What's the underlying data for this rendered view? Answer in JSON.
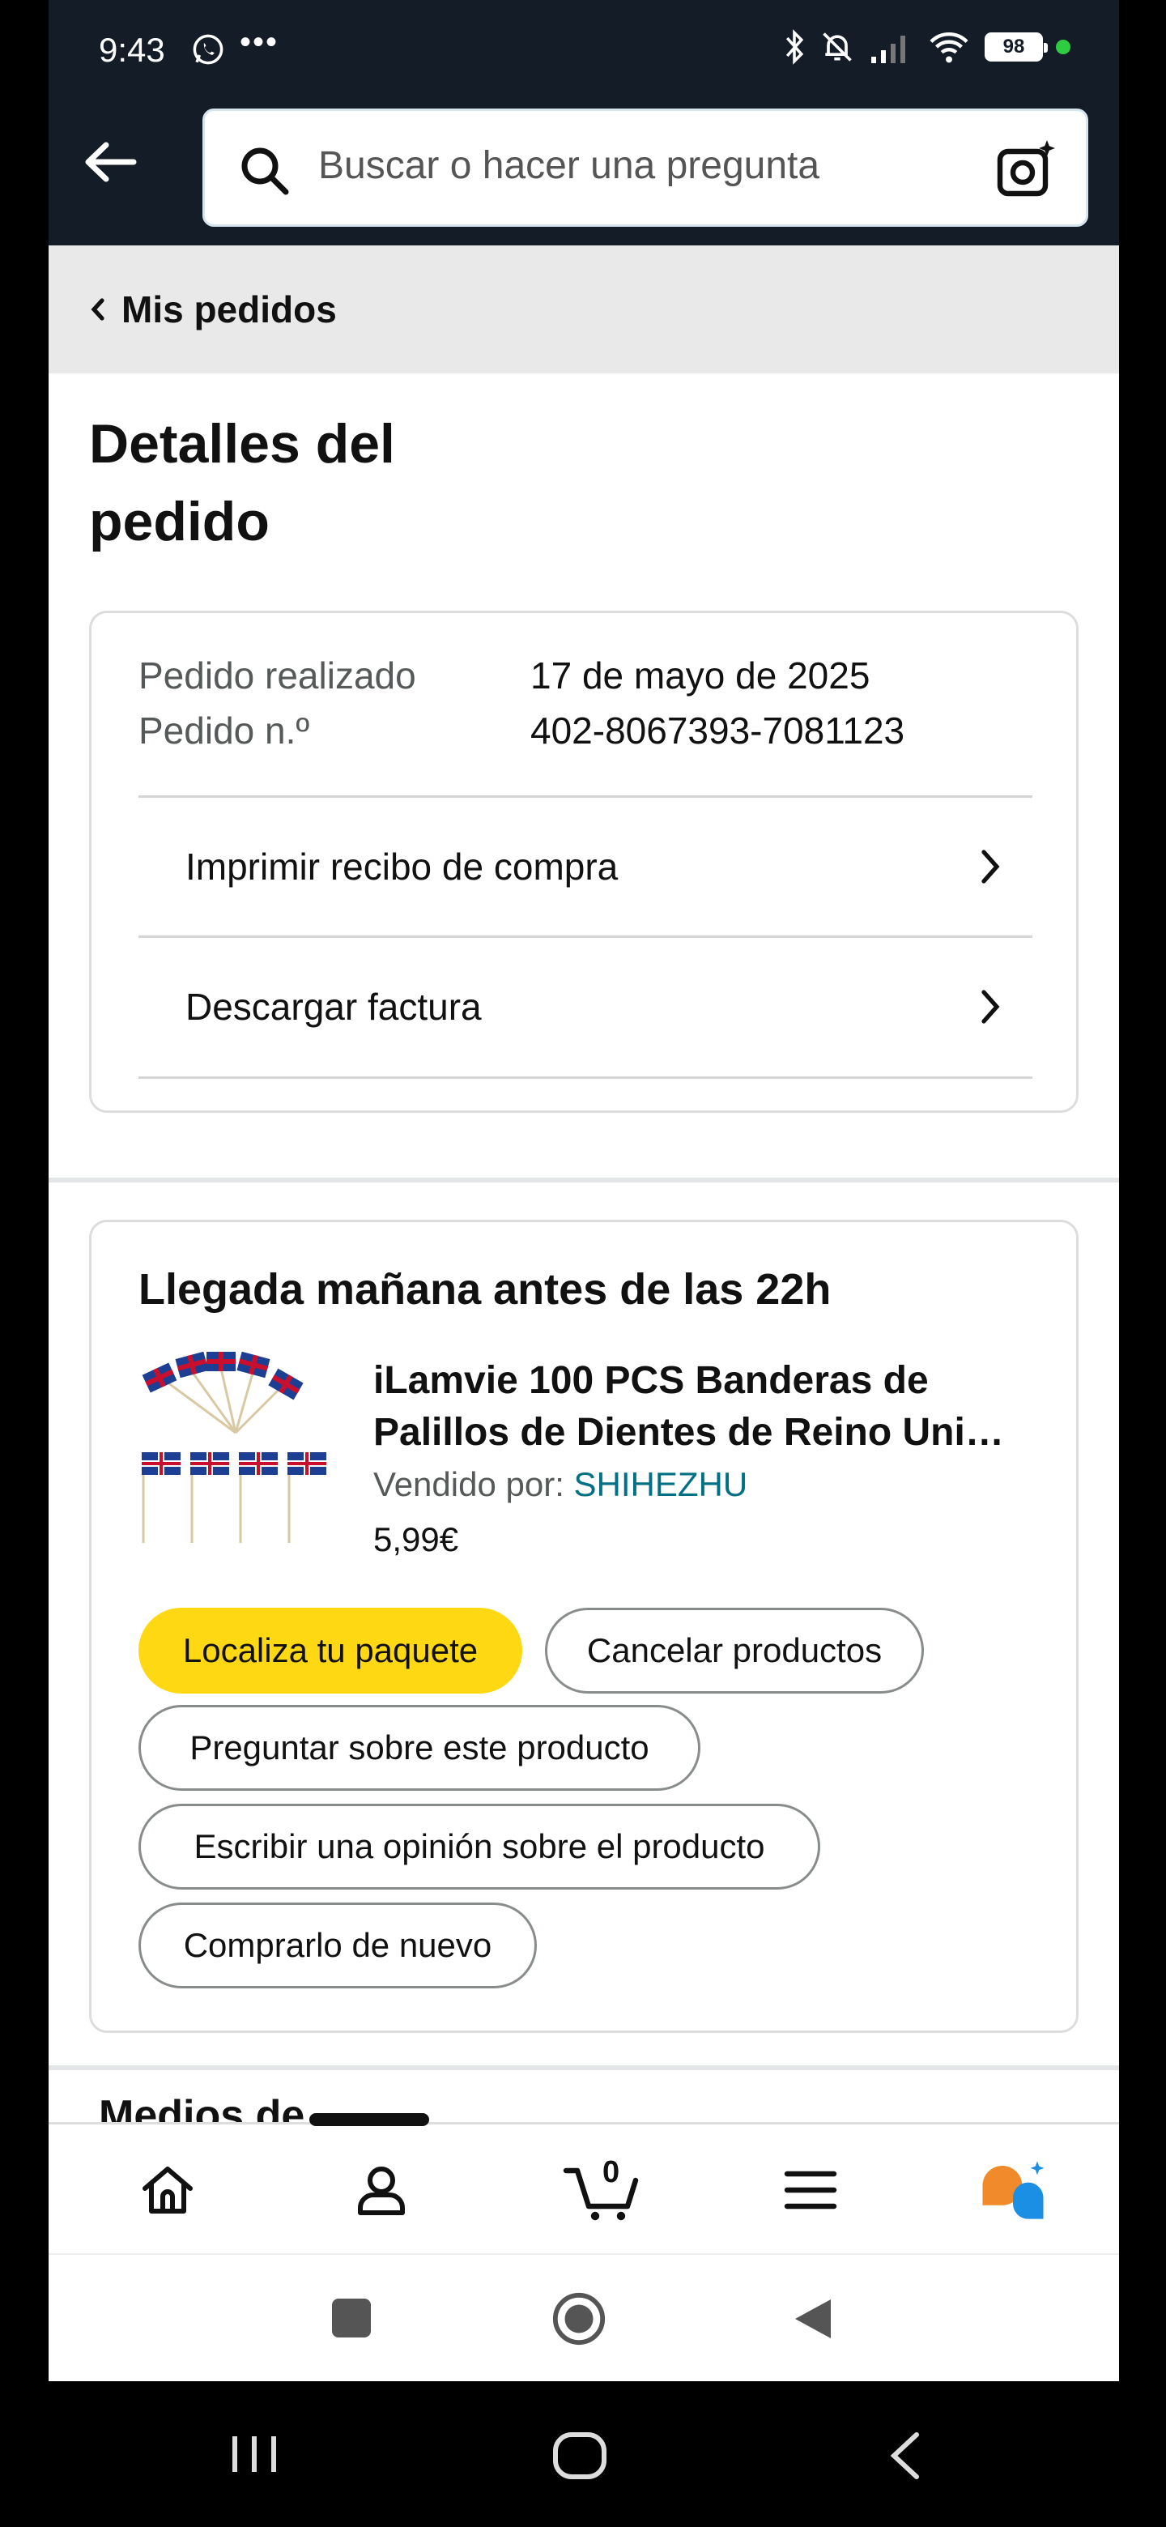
{
  "status_bar": {
    "time": "9:43",
    "dots": "•••",
    "battery": "98"
  },
  "search": {
    "placeholder": "Buscar o hacer una pregunta"
  },
  "breadcrumb": {
    "label": "Mis pedidos"
  },
  "page": {
    "title": "Detalles del pedido"
  },
  "order": {
    "placed_label": "Pedido realizado",
    "placed_value": "17 de mayo de 2025",
    "number_label": "Pedido n.º",
    "number_value": "402-8067393-7081123",
    "links": [
      "Imprimir recibo de compra",
      "Descargar factura"
    ]
  },
  "shipment": {
    "delivery": "Llegada mañana antes de las 22h",
    "product_title": "iLamvie 100 PCS Banderas de Palillos de Dientes de Reino Uni…",
    "seller_label": "Vendido por:",
    "seller_name": "SHIHEZHU",
    "price": "5,99€",
    "buttons": {
      "track": "Localiza tu paquete",
      "cancel": "Cancelar productos",
      "ask": "Preguntar sobre este producto",
      "review": "Escribir una opinión sobre el producto",
      "buy_again": "Comprarlo de nuevo"
    }
  },
  "next_section_partial": "Medios de",
  "bottom_nav": {
    "cart_count": "0",
    "items": [
      "home-icon",
      "account-icon",
      "cart-icon",
      "menu-icon",
      "rufus-icon"
    ]
  },
  "colors": {
    "header_bg": "#141d27",
    "primary_button": "#ffd814",
    "link": "#007185",
    "rufus_orange": "#f08a2a",
    "rufus_blue": "#1a8fe3"
  }
}
